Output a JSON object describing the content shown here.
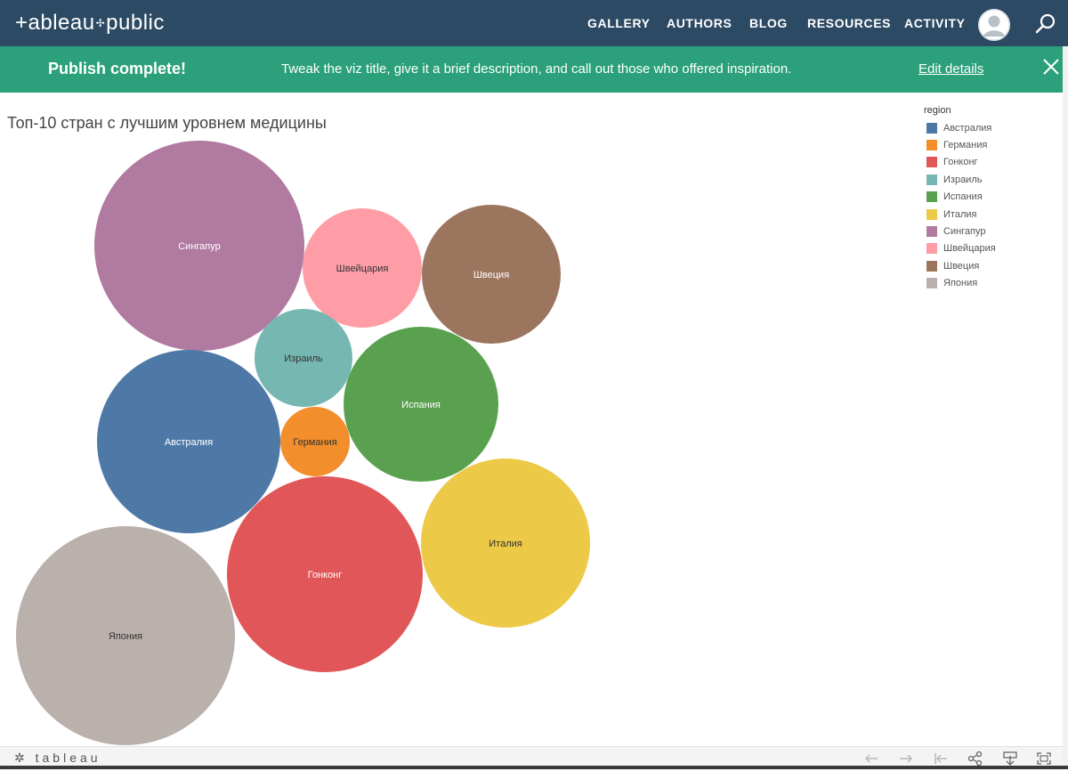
{
  "header": {
    "logo": "+ableau",
    "logo_suffix": "public",
    "nav": [
      {
        "label": "GALLERY"
      },
      {
        "label": "AUTHORS"
      },
      {
        "label": "BLOG"
      },
      {
        "label": "RESOURCES"
      },
      {
        "label": "ACTIVITY"
      }
    ],
    "bg_color": "#2d4a64"
  },
  "banner": {
    "title": "Publish complete!",
    "message": "Tweak the viz title, give it a brief description, and call out those who offered inspiration.",
    "link": "Edit details",
    "bg_color": "#2ba07b"
  },
  "viz": {
    "title": "Топ-10 стран с лучшим уровнем медицины",
    "legend_title": "region"
  },
  "chart_data": {
    "type": "packed-bubble",
    "title": "Топ-10 стран с лучшим уровнем медицины",
    "legend_title": "region",
    "legend": [
      {
        "name": "Австралия",
        "color": "#4e79a7"
      },
      {
        "name": "Германия",
        "color": "#f28e2b"
      },
      {
        "name": "Гонконг",
        "color": "#e15759"
      },
      {
        "name": "Израиль",
        "color": "#76b7b2"
      },
      {
        "name": "Испания",
        "color": "#59a14f"
      },
      {
        "name": "Италия",
        "color": "#edc948"
      },
      {
        "name": "Сингапур",
        "color": "#b07aa1"
      },
      {
        "name": "Швейцария",
        "color": "#ff9da7"
      },
      {
        "name": "Швеция",
        "color": "#9c755f"
      },
      {
        "name": "Япония",
        "color": "#bab0ac"
      }
    ],
    "bubbles": [
      {
        "label": "Сингапур",
        "relative_size": 1.0,
        "color": "#b07aa1",
        "label_color": "#ffffff"
      },
      {
        "label": "Япония",
        "relative_size": 1.05,
        "color": "#bab0ac",
        "label_color": "#333333"
      },
      {
        "label": "Гонконг",
        "relative_size": 0.94,
        "color": "#e15759",
        "label_color": "#ffffff"
      },
      {
        "label": "Австралия",
        "relative_size": 0.88,
        "color": "#4e79a7",
        "label_color": "#ffffff"
      },
      {
        "label": "Италия",
        "relative_size": 0.81,
        "color": "#edc948",
        "label_color": "#333333"
      },
      {
        "label": "Испания",
        "relative_size": 0.74,
        "color": "#59a14f",
        "label_color": "#ffffff"
      },
      {
        "label": "Швеция",
        "relative_size": 0.67,
        "color": "#9c755f",
        "label_color": "#ffffff"
      },
      {
        "label": "Швейцария",
        "relative_size": 0.57,
        "color": "#ff9da7",
        "label_color": "#333333"
      },
      {
        "label": "Израиль",
        "relative_size": 0.47,
        "color": "#76b7b2",
        "label_color": "#333333"
      },
      {
        "label": "Германия",
        "relative_size": 0.33,
        "color": "#f28e2b",
        "label_color": "#333333"
      }
    ]
  },
  "footer": {
    "logo": "tableau"
  },
  "icons": {
    "search": "search-icon",
    "close": "close-icon",
    "avatar": "user-avatar-icon",
    "undo": "undo-icon",
    "redo": "redo-icon",
    "revert": "revert-icon",
    "share": "share-icon",
    "download": "download-icon",
    "fullscreen": "fullscreen-icon"
  }
}
